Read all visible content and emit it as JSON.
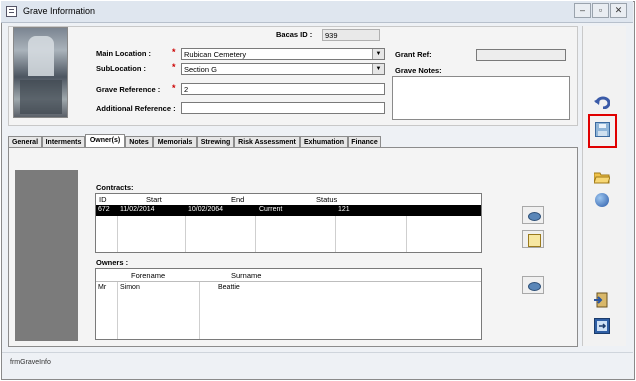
{
  "window": {
    "title": "Grave Information",
    "status_text": "frmGraveInfo"
  },
  "header": {
    "bacas_id_label": "Bacas ID :",
    "bacas_id_value": "939",
    "main_location_label": "Main Location :",
    "main_location_value": "Rubican Cemetery",
    "sublocation_label": "SubLocation :",
    "sublocation_value": "Section G",
    "grave_reference_label": "Grave Reference :",
    "grave_reference_value": "2",
    "additional_reference_label": "Additional Reference :",
    "additional_reference_value": "",
    "grant_ref_label": "Grant Ref:",
    "grant_ref_value": "",
    "grave_notes_label": "Grave Notes:",
    "required_mark": "*"
  },
  "tabs": [
    {
      "label": "General"
    },
    {
      "label": "Interments"
    },
    {
      "label": "Owner(s)"
    },
    {
      "label": "Notes"
    },
    {
      "label": "Memorials"
    },
    {
      "label": "Strewing"
    },
    {
      "label": "Risk Assessment"
    },
    {
      "label": "Exhumation"
    },
    {
      "label": "Finance"
    }
  ],
  "contracts": {
    "title": "Contracts:",
    "columns": [
      "ID",
      "Start",
      "End",
      "Status"
    ],
    "rows": [
      {
        "id": "672",
        "start": "11/02/2014",
        "end": "10/02/2064",
        "status": "Current",
        "extra": "121"
      }
    ]
  },
  "owners": {
    "title": "Owners :",
    "columns": [
      "Forename",
      "Surname"
    ],
    "rows": [
      {
        "title": "Mr",
        "forename": "Simon",
        "surname": "Beattie"
      }
    ]
  },
  "colors": {
    "highlight": "#e00000",
    "selected_row": "#000000"
  }
}
